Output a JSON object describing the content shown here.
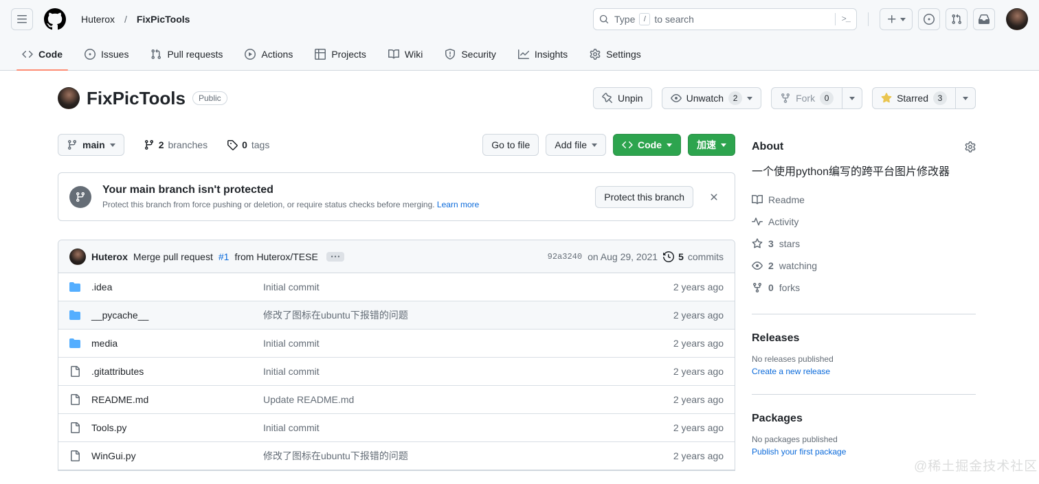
{
  "header": {
    "breadcrumb": {
      "owner": "Huterox",
      "separator": "/",
      "repo": "FixPicTools"
    },
    "search": {
      "prefix": "Type",
      "slash_key": "/",
      "suffix": "to search",
      "command_glyph": ">_"
    }
  },
  "nav": {
    "tabs": [
      {
        "label": "Code"
      },
      {
        "label": "Issues"
      },
      {
        "label": "Pull requests"
      },
      {
        "label": "Actions"
      },
      {
        "label": "Projects"
      },
      {
        "label": "Wiki"
      },
      {
        "label": "Security"
      },
      {
        "label": "Insights"
      },
      {
        "label": "Settings"
      }
    ]
  },
  "repo": {
    "name": "FixPicTools",
    "visibility": "Public"
  },
  "head_actions": {
    "unpin": "Unpin",
    "watch_label": "Unwatch",
    "watch_count": "2",
    "fork_label": "Fork",
    "fork_count": "0",
    "star_label": "Starred",
    "star_count": "3"
  },
  "toolbar": {
    "branch": "main",
    "branches_count": "2",
    "branches_label": "branches",
    "tags_count": "0",
    "tags_label": "tags",
    "goto_file": "Go to file",
    "add_file": "Add file",
    "code_label": "Code",
    "boost_label": "加速"
  },
  "banner": {
    "title": "Your main branch isn't protected",
    "description": "Protect this branch from force pushing or deletion, or require status checks before merging.",
    "learn_more": "Learn more",
    "protect_button": "Protect this branch"
  },
  "commit": {
    "author": "Huterox",
    "message": "Merge pull request",
    "pr_link": "#1",
    "message_rest": "from Huterox/TESE",
    "hash": "92a3240",
    "date": "on Aug 29, 2021",
    "count": "5",
    "count_label": "commits"
  },
  "files": {
    "rows": [
      {
        "name": ".idea",
        "message": "Initial commit",
        "age": "2 years ago"
      },
      {
        "name": "__pycache__",
        "message": "修改了图标在ubuntu下报错的问题",
        "age": "2 years ago"
      },
      {
        "name": "media",
        "message": "Initial commit",
        "age": "2 years ago"
      },
      {
        "name": ".gitattributes",
        "message": "Initial commit",
        "age": "2 years ago"
      },
      {
        "name": "README.md",
        "message": "Update README.md",
        "age": "2 years ago"
      },
      {
        "name": "Tools.py",
        "message": "Initial commit",
        "age": "2 years ago"
      },
      {
        "name": "WinGui.py",
        "message": "修改了图标在ubuntu下报错的问题",
        "age": "2 years ago"
      }
    ]
  },
  "sidebar": {
    "about": {
      "title": "About",
      "description": "一个使用python编写的跨平台图片修改器",
      "readme": "Readme",
      "activity": "Activity",
      "stars_count": "3",
      "stars_label": "stars",
      "watching_count": "2",
      "watching_label": "watching",
      "forks_count": "0",
      "forks_label": "forks"
    },
    "releases": {
      "title": "Releases",
      "empty": "No releases published",
      "cta": "Create a new release"
    },
    "packages": {
      "title": "Packages",
      "empty": "No packages published",
      "cta": "Publish your first package"
    }
  },
  "watermark": "@稀土掘金技术社区",
  "colors": {
    "header_bg": "#f6f8fa",
    "border": "#d0d7de",
    "link_blue": "#0969da",
    "button_green": "#2da44e",
    "tab_underline": "#fd8c73",
    "star_yellow": "#eac54f",
    "folder_blue": "#54aeff",
    "text_muted": "#636c76"
  }
}
